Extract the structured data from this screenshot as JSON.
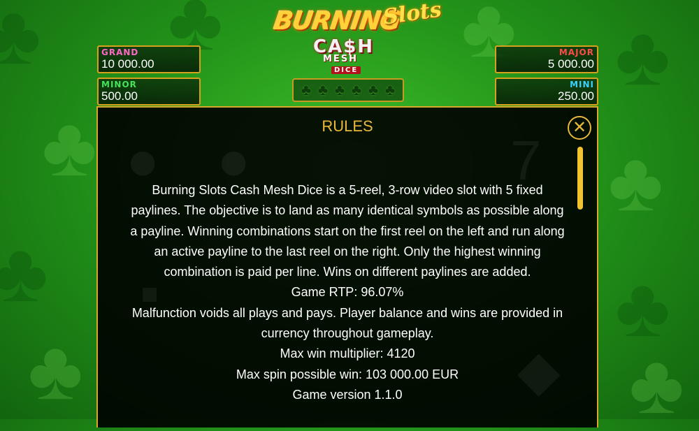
{
  "logo": {
    "line1": "BURNING",
    "line2": "Slots",
    "line3": "CA$H",
    "line4": "MESH",
    "line5": "DICE"
  },
  "jackpots": {
    "grand": {
      "label": "GRAND",
      "value": "10 000.00",
      "color": "#ff66c8"
    },
    "minor": {
      "label": "MINOR",
      "value": "500.00",
      "color": "#46e25a"
    },
    "major": {
      "label": "MAJOR",
      "value": "5 000.00",
      "color": "#ff4a4a"
    },
    "mini": {
      "label": "MINI",
      "value": "250.00",
      "color": "#3ad2ff"
    }
  },
  "clover_slots": [
    "clover-icon",
    "clover-icon",
    "clover-icon",
    "clover-icon",
    "clover-icon",
    "clover-icon"
  ],
  "rules": {
    "title": "RULES",
    "close_icon": "close-icon",
    "paragraphs": [
      "Burning Slots Cash Mesh Dice is a 5-reel, 3-row video slot with 5 fixed paylines. The objective is to land as many identical symbols as possible along a payline. Winning combinations start on the first reel on the left and run along an active payline to the last reel on the right. Only the highest winning combination is paid per line. Wins on different paylines are added.",
      "Game RTP: 96.07%",
      "Malfunction voids all plays and pays. Player balance and wins are provided in currency throughout gameplay.",
      "Max win multiplier: 4120",
      "Max spin possible win: 103 000.00 EUR",
      "Game version 1.1.0"
    ]
  },
  "colors": {
    "accent_gold": "#e8b83a",
    "panel_bg": "#000000",
    "background_green": "#23951a"
  }
}
